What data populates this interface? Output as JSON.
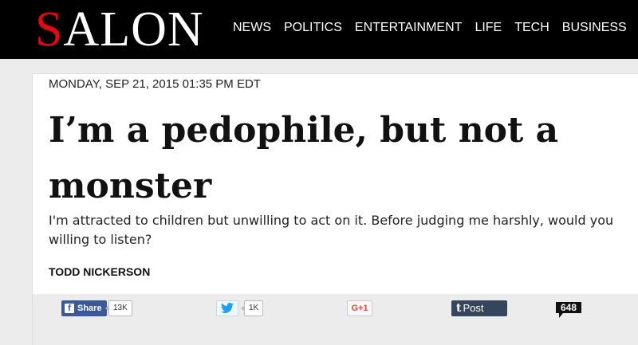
{
  "header": {
    "logo": {
      "first_letter": "S",
      "rest": "ALON"
    },
    "nav": [
      "NEWS",
      "POLITICS",
      "ENTERTAINMENT",
      "LIFE",
      "TECH",
      "BUSINESS"
    ]
  },
  "article": {
    "dateline": "MONDAY, SEP 21, 2015 01:35 PM EDT",
    "headline_line1": "I’m a pedophile, but not a",
    "headline_line2": "monster",
    "dek": "I'm attracted to children but unwilling to act on it. Before judging me harshly, would you willing to listen?",
    "byline": "TODD NICKERSON"
  },
  "share": {
    "facebook_icon": "f",
    "facebook_label": "Share",
    "facebook_count": "13K",
    "twitter_count": "1K",
    "gplus_label": "G+1",
    "tumblr_icon": "t",
    "tumblr_label": "Post",
    "comment_count": "648"
  },
  "colors": {
    "brand_red": "#e30613",
    "facebook": "#3b5998",
    "tumblr": "#35465c",
    "twitter": "#1da1f2"
  },
  "icons": [
    "twitter-bird-icon",
    "facebook-f-icon",
    "tumblr-t-icon"
  ]
}
